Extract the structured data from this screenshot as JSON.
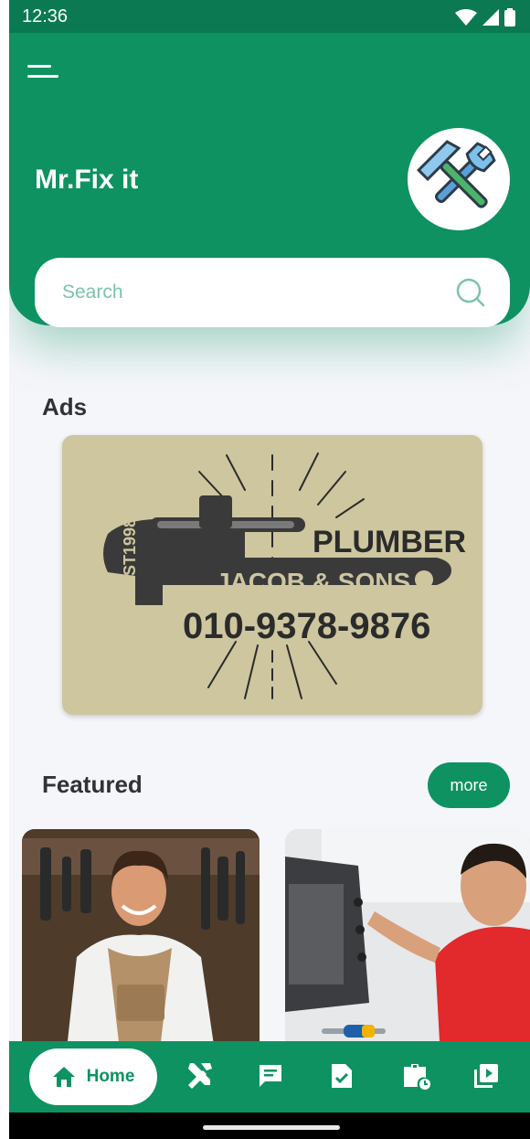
{
  "status": {
    "time": "12:36"
  },
  "header": {
    "title": "Mr.Fix it",
    "search_placeholder": "Search"
  },
  "ads": {
    "title": "Ads",
    "banner": {
      "heading": "PLUMBER",
      "company": "JACOB & SONS",
      "established": "EST1998",
      "phone": "010-9378-9876"
    }
  },
  "featured": {
    "title": "Featured",
    "more_label": "more"
  },
  "bottom_nav": {
    "home_label": "Home",
    "items": [
      "tools-icon",
      "chat-icon",
      "task-check-icon",
      "work-schedule-icon",
      "video-library-icon"
    ]
  },
  "colors": {
    "primary": "#0e9261",
    "status_bar": "#0b7a52",
    "background": "#f5f6fa",
    "ad_background": "#cdc69f"
  }
}
